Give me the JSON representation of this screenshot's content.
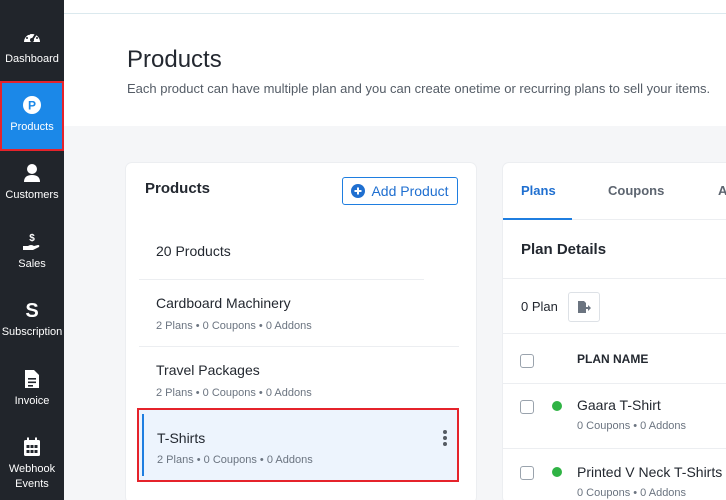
{
  "sidebar": {
    "items": [
      {
        "label": "Dashboard",
        "icon": "gauge-icon",
        "active": false
      },
      {
        "label": "Products",
        "icon": "product-p-icon",
        "active": true
      },
      {
        "label": "Customers",
        "icon": "user-icon",
        "active": false
      },
      {
        "label": "Sales",
        "icon": "hand-dollar-icon",
        "active": false
      },
      {
        "label": "Subscription",
        "icon": "subscription-s-icon",
        "active": false
      },
      {
        "label": "Invoice",
        "icon": "document-icon",
        "active": false
      },
      {
        "label": "Webhook",
        "label2": "Events",
        "icon": "calendar-icon",
        "active": false
      }
    ]
  },
  "header": {
    "title": "Products",
    "subtitle": "Each product can have multiple plan and you can create onetime or recurring plans to sell your items."
  },
  "products_panel": {
    "title": "Products",
    "add_button": "Add Product",
    "count_label": "20 Products",
    "items": [
      {
        "name": "Cardboard Machinery",
        "meta": "2 Plans  • 0 Coupons  • 0 Addons",
        "selected": false
      },
      {
        "name": "Travel Packages",
        "meta": "2 Plans  • 0 Coupons  • 0 Addons",
        "selected": false
      },
      {
        "name": "T-Shirts",
        "meta": "2 Plans  • 0 Coupons  • 0 Addons",
        "selected": true
      }
    ]
  },
  "detail_panel": {
    "tabs": [
      "Plans",
      "Coupons",
      "A"
    ],
    "active_tab": "Plans",
    "section_title": "Plan Details",
    "plan_count": "0 Plan",
    "column_header": "PLAN NAME",
    "plans": [
      {
        "name": "Gaara T-Shirt",
        "meta": "0 Coupons  • 0 Addons",
        "status": "active"
      },
      {
        "name": "Printed V Neck T-Shirts",
        "meta": "0 Coupons  • 0 Addons",
        "status": "active"
      }
    ]
  },
  "colors": {
    "sidebar_bg": "#21252b",
    "accent": "#1b88e8",
    "highlight_border": "#e5232b",
    "status_active": "#2fb344"
  }
}
